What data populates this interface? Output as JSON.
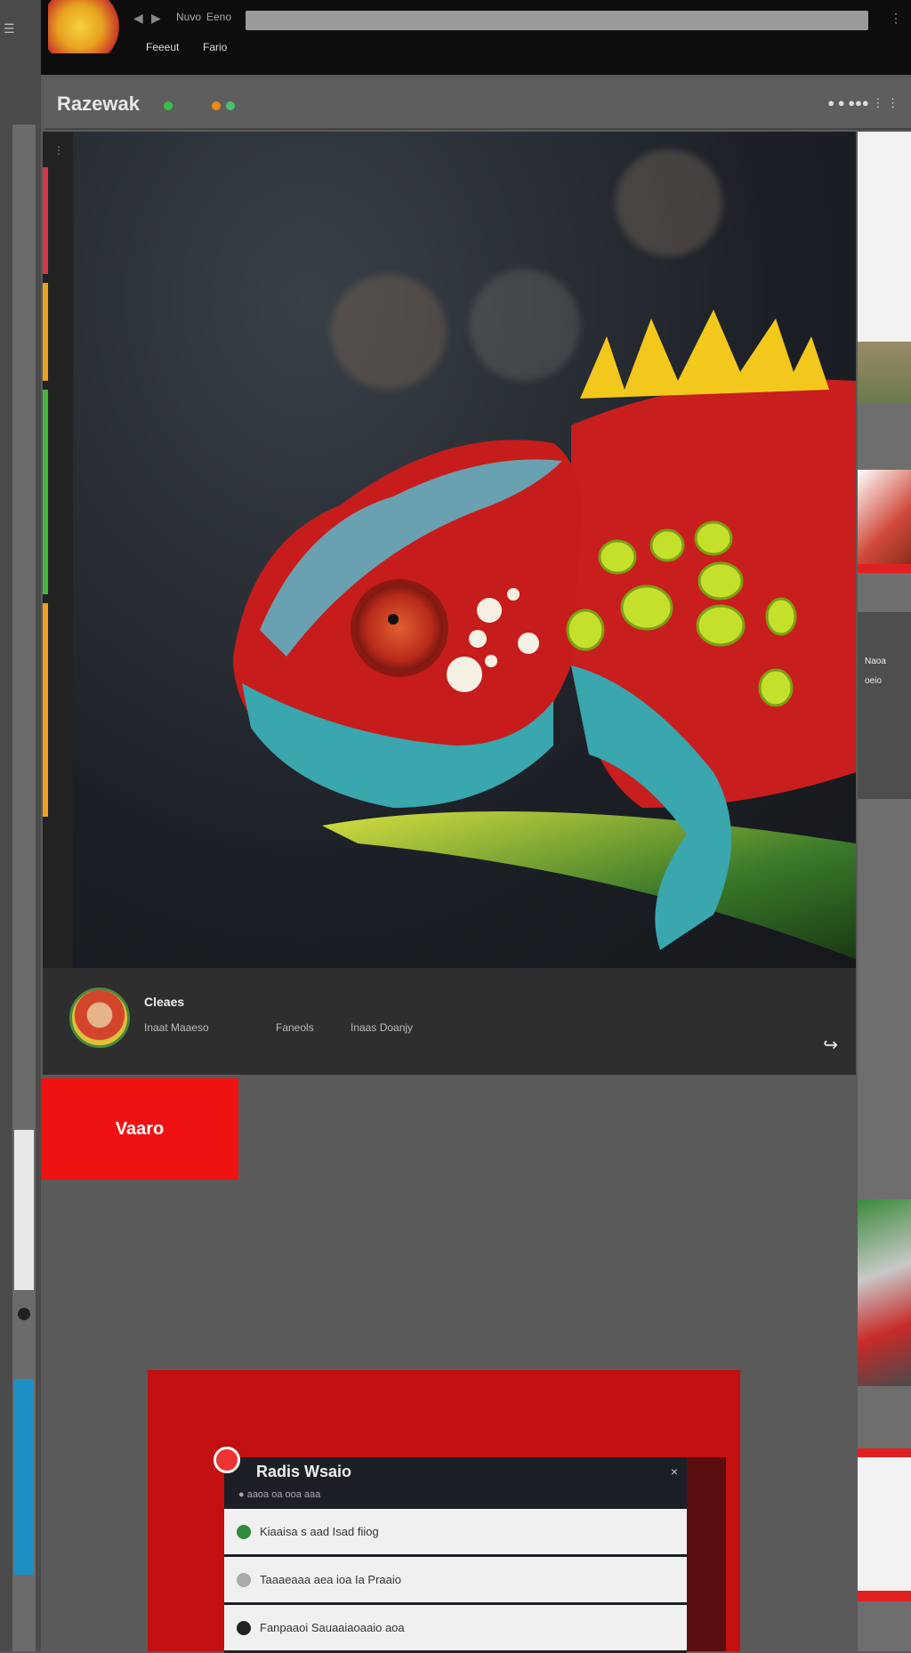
{
  "browser": {
    "nav_icons": [
      "◀",
      "▶"
    ],
    "links": [
      "Nuvo",
      "Eeno"
    ],
    "address": "",
    "menu_icon": "⋮",
    "sub_links": [
      "Feeeut",
      "Fario"
    ]
  },
  "app": {
    "title": "Razewak",
    "header_right": "● ● ●●● ⋮ ⋮",
    "status_colors": [
      "#3bbf4a",
      "#e88a1a",
      "#4ac06a"
    ]
  },
  "post": {
    "author": "Cleaes",
    "meta": [
      "Inaat Maaeso",
      "Faneols",
      "Inaas Doanjy"
    ],
    "share_icon": "share-icon",
    "rail_colors": [
      "#d8354a",
      "#e8a21f",
      "#46b542",
      "#f0a020"
    ]
  },
  "actions": {
    "vote_label": "Vaaro"
  },
  "preview": {
    "title": "Radis Wsaio",
    "subtitle": "● aaoa oa ooa aaa",
    "rows": [
      {
        "label": "Kiaaisa s aad Isad fiiog",
        "icon_color": "#2f8a3a"
      },
      {
        "label": "Taaaeaaa aea ioa Ia Praaio",
        "icon_color": "#aaaaaa"
      },
      {
        "label": "Fanpaaoi Sauaaiaoaaio aoa",
        "icon_color": "#222222"
      }
    ]
  },
  "right_column": {
    "thumb_texts": [
      "Naoa",
      "oeio"
    ]
  }
}
